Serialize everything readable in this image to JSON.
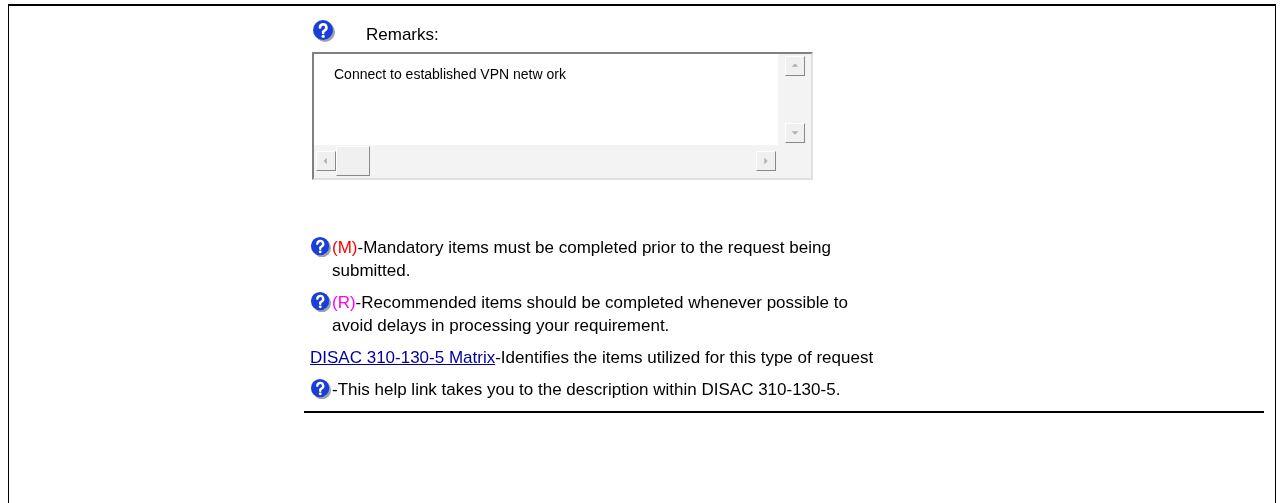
{
  "remarks": {
    "label": "Remarks:",
    "value": "Connect to established VPN netw ork"
  },
  "legend": [
    {
      "kind": "help",
      "marker": "(M)",
      "color": "#ff0000",
      "text": "-Mandatory items must be completed prior to the request being submitted."
    },
    {
      "kind": "help",
      "marker": "(R)",
      "color": "#ff00ff",
      "text": "-Recommended items should be completed whenever possible to avoid delays in processing your requirement."
    },
    {
      "kind": "link",
      "link": "DISAC 310-130-5 Matrix",
      "text": "-Identifies the items utilized for this type of request"
    },
    {
      "kind": "help",
      "text": "-This help link takes you to the description within DISAC 310-130-5."
    }
  ]
}
